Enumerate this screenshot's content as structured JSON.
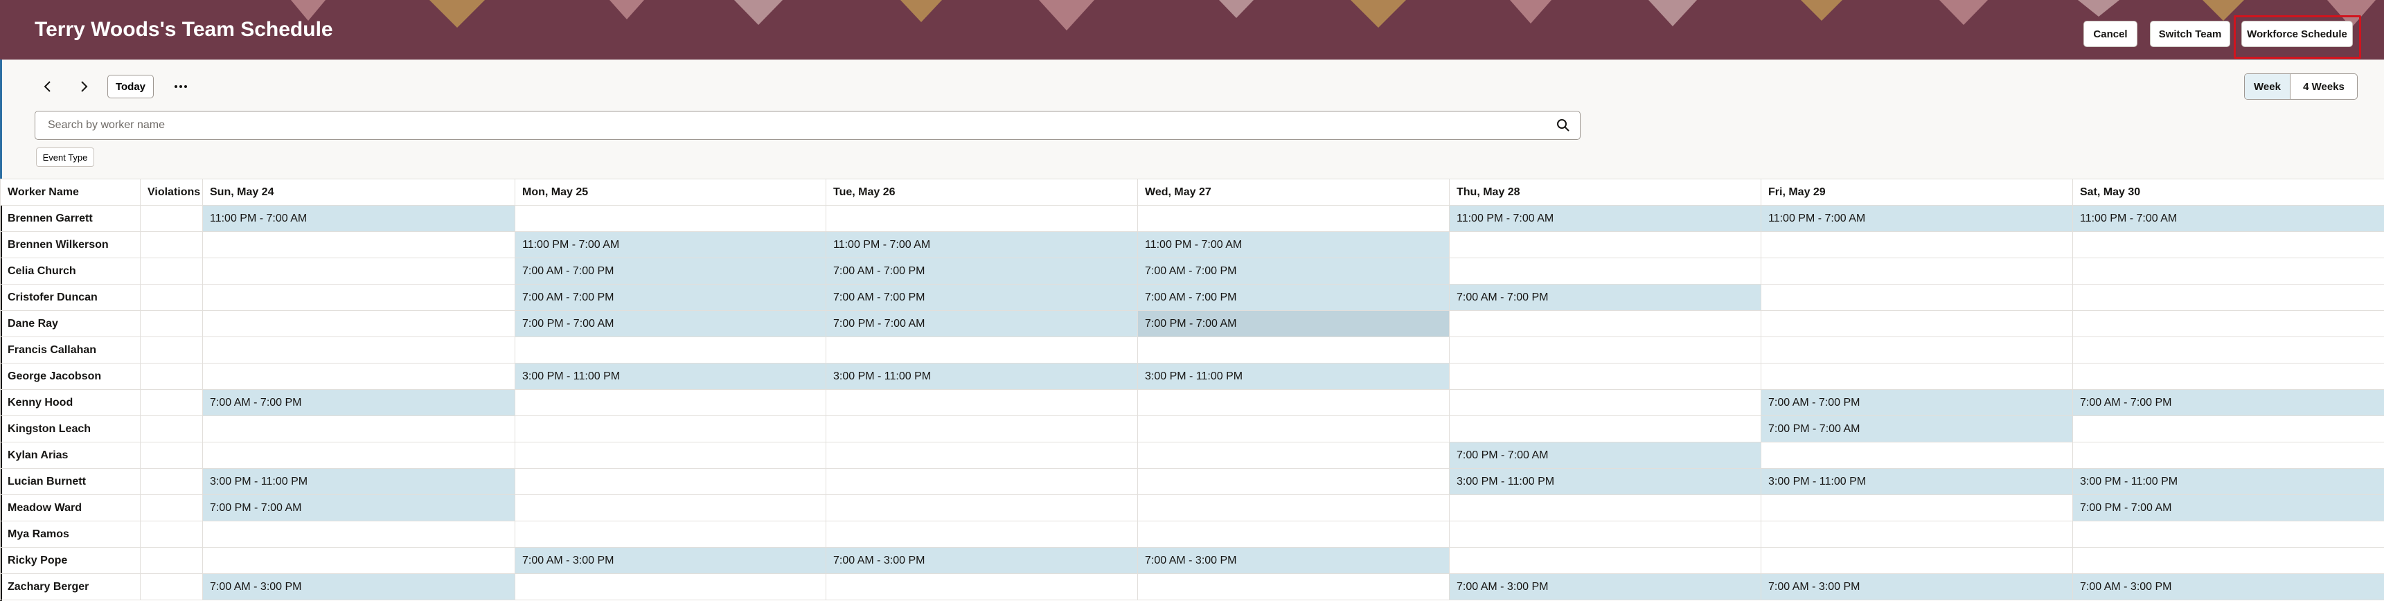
{
  "header": {
    "title": "Terry Woods's Team Schedule",
    "cancel_label": "Cancel",
    "switch_team_label": "Switch Team",
    "workforce_schedule_label": "Workforce Schedule",
    "background_color": "#6e3a49"
  },
  "toolbar": {
    "prev_icon": "chevron-left-icon",
    "next_icon": "chevron-right-icon",
    "today_label": "Today",
    "more_icon": "more-horizontal-icon",
    "view_options": [
      "Week",
      "4 Weeks"
    ],
    "selected_view": "Week"
  },
  "search": {
    "placeholder": "Search by worker name",
    "icon": "search-icon"
  },
  "filter": {
    "event_type_label": "Event Type"
  },
  "schedule": {
    "col_worker": "Worker Name",
    "col_violations": "Violations",
    "days": [
      "Sun, May 24",
      "Mon, May 25",
      "Tue, May 26",
      "Wed, May 27",
      "Thu, May 28",
      "Fri, May 29",
      "Sat, May 30"
    ],
    "shift_color": "#d0e4ec",
    "rows": [
      {
        "name": "Brennen Garrett",
        "shifts": [
          "11:00 PM - 7:00 AM",
          "",
          "",
          "",
          "11:00 PM - 7:00 AM",
          "11:00 PM - 7:00 AM",
          "11:00 PM - 7:00 AM"
        ]
      },
      {
        "name": "Brennen Wilkerson",
        "shifts": [
          "",
          "11:00 PM - 7:00 AM",
          "11:00 PM - 7:00 AM",
          "11:00 PM - 7:00 AM",
          "",
          "",
          ""
        ]
      },
      {
        "name": "Celia Church",
        "shifts": [
          "",
          "7:00 AM - 7:00 PM",
          "7:00 AM - 7:00 PM",
          "7:00 AM - 7:00 PM",
          "",
          "",
          ""
        ]
      },
      {
        "name": "Cristofer Duncan",
        "shifts": [
          "",
          "7:00 AM - 7:00 PM",
          "7:00 AM - 7:00 PM",
          "7:00 AM - 7:00 PM",
          "7:00 AM - 7:00 PM",
          "",
          ""
        ]
      },
      {
        "name": "Dane Ray",
        "shifts": [
          "",
          "7:00 PM - 7:00 AM",
          "7:00 PM - 7:00 AM",
          "7:00 PM - 7:00 AM",
          "",
          "",
          ""
        ]
      },
      {
        "name": "Francis Callahan",
        "shifts": [
          "",
          "",
          "",
          "",
          "",
          "",
          ""
        ]
      },
      {
        "name": "George Jacobson",
        "shifts": [
          "",
          "3:00 PM - 11:00 PM",
          "3:00 PM - 11:00 PM",
          "3:00 PM - 11:00 PM",
          "",
          "",
          ""
        ]
      },
      {
        "name": "Kenny Hood",
        "shifts": [
          "7:00 AM - 7:00 PM",
          "",
          "",
          "",
          "",
          "7:00 AM - 7:00 PM",
          "7:00 AM - 7:00 PM"
        ]
      },
      {
        "name": "Kingston Leach",
        "shifts": [
          "",
          "",
          "",
          "",
          "",
          "7:00 PM - 7:00 AM",
          ""
        ]
      },
      {
        "name": "Kylan Arias",
        "shifts": [
          "",
          "",
          "",
          "",
          "7:00 PM - 7:00 AM",
          "",
          ""
        ]
      },
      {
        "name": "Lucian Burnett",
        "shifts": [
          "3:00 PM - 11:00 PM",
          "",
          "",
          "",
          "3:00 PM - 11:00 PM",
          "3:00 PM - 11:00 PM",
          "3:00 PM - 11:00 PM"
        ]
      },
      {
        "name": "Meadow Ward",
        "shifts": [
          "7:00 PM - 7:00 AM",
          "",
          "",
          "",
          "",
          "",
          "7:00 PM - 7:00 AM"
        ]
      },
      {
        "name": "Mya Ramos",
        "shifts": [
          "",
          "",
          "",
          "",
          "",
          "",
          ""
        ]
      },
      {
        "name": "Ricky Pope",
        "shifts": [
          "",
          "7:00 AM - 3:00 PM",
          "7:00 AM - 3:00 PM",
          "7:00 AM - 3:00 PM",
          "",
          "",
          ""
        ]
      },
      {
        "name": "Zachary Berger",
        "shifts": [
          "7:00 AM - 3:00 PM",
          "",
          "",
          "",
          "7:00 AM - 3:00 PM",
          "7:00 AM - 3:00 PM",
          "7:00 AM - 3:00 PM"
        ]
      }
    ]
  }
}
